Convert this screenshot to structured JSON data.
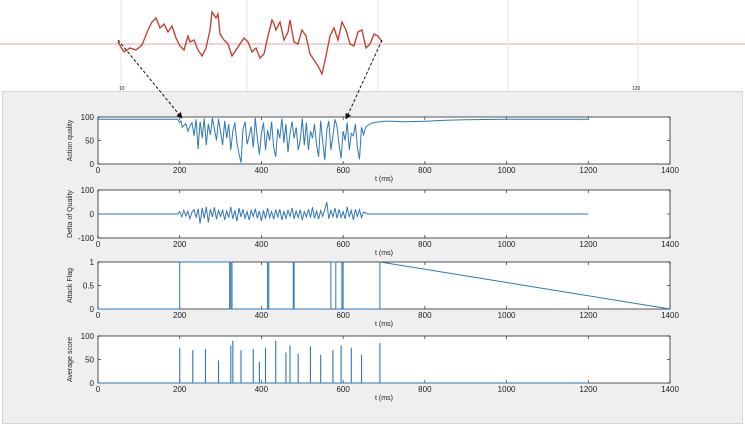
{
  "chart_data": [
    {
      "type": "line",
      "ylabel": "Action quality",
      "xlabel": "t (ms)",
      "xlim": [
        0,
        1400
      ],
      "ylim": [
        0,
        100
      ],
      "xticks": [
        "0",
        "200",
        "400",
        "600",
        "800",
        "1000",
        "1200",
        "1400"
      ],
      "yticks": [
        "0",
        "50",
        "100"
      ],
      "color": "#2f77b5",
      "series": [
        {
          "x": [
            0,
            195,
            200,
            203,
            206,
            210,
            215,
            220,
            225,
            230,
            235,
            240,
            245,
            250,
            255,
            260,
            265,
            270,
            275,
            280,
            285,
            290,
            295,
            300,
            305,
            310,
            315,
            320,
            325,
            330,
            335,
            340,
            345,
            350,
            355,
            360,
            365,
            370,
            375,
            380,
            385,
            390,
            395,
            400,
            405,
            410,
            415,
            420,
            425,
            430,
            435,
            440,
            445,
            450,
            455,
            460,
            465,
            470,
            475,
            480,
            485,
            490,
            495,
            500,
            505,
            510,
            515,
            520,
            525,
            530,
            535,
            540,
            545,
            550,
            555,
            560,
            565,
            570,
            575,
            580,
            585,
            590,
            595,
            600,
            605,
            610,
            615,
            620,
            625,
            630,
            635,
            640,
            645,
            650,
            655,
            660,
            670,
            680,
            690,
            700,
            720,
            750,
            800,
            850,
            900,
            1000,
            1100,
            1200
          ],
          "y": [
            95,
            95,
            88,
            92,
            78,
            82,
            86,
            70,
            80,
            88,
            60,
            95,
            32,
            90,
            55,
            97,
            40,
            85,
            62,
            98,
            75,
            50,
            96,
            68,
            40,
            92,
            55,
            85,
            30,
            70,
            88,
            45,
            22,
            3,
            75,
            90,
            42,
            60,
            80,
            35,
            98,
            55,
            20,
            65,
            88,
            30,
            72,
            50,
            90,
            35,
            15,
            75,
            55,
            97,
            45,
            85,
            25,
            65,
            90,
            55,
            78,
            30,
            50,
            97,
            40,
            88,
            30,
            70,
            55,
            85,
            40,
            15,
            92,
            48,
            8,
            72,
            92,
            30,
            60,
            95,
            80,
            40,
            12,
            70,
            50,
            88,
            30,
            65,
            60,
            85,
            35,
            10,
            78,
            62,
            78,
            82,
            87,
            89,
            90,
            91,
            91,
            90,
            91,
            93,
            94,
            95,
            95,
            95
          ]
        }
      ]
    },
    {
      "type": "line",
      "ylabel": "Delta of Quality",
      "xlabel": "t (ms)",
      "xlim": [
        0,
        1400
      ],
      "ylim": [
        -100,
        100
      ],
      "xticks": [
        "0",
        "200",
        "400",
        "600",
        "800",
        "1000",
        "1200",
        "1400"
      ],
      "yticks": [
        "-100",
        "0",
        "100"
      ],
      "color": "#2f77b5",
      "series": [
        {
          "x": [
            0,
            195,
            200,
            205,
            210,
            215,
            220,
            225,
            230,
            235,
            240,
            245,
            250,
            255,
            260,
            265,
            270,
            275,
            280,
            285,
            290,
            295,
            300,
            305,
            310,
            315,
            320,
            325,
            330,
            335,
            340,
            345,
            350,
            355,
            360,
            365,
            370,
            375,
            380,
            385,
            390,
            395,
            400,
            405,
            410,
            415,
            420,
            425,
            430,
            435,
            440,
            445,
            450,
            455,
            460,
            465,
            470,
            475,
            480,
            485,
            490,
            495,
            500,
            505,
            510,
            515,
            520,
            525,
            530,
            535,
            540,
            545,
            550,
            555,
            560,
            565,
            570,
            575,
            580,
            585,
            590,
            595,
            600,
            605,
            610,
            615,
            620,
            625,
            630,
            635,
            640,
            645,
            650,
            660,
            1200
          ],
          "y": [
            0,
            0,
            10,
            -12,
            15,
            -8,
            12,
            -20,
            8,
            18,
            -15,
            22,
            -40,
            25,
            -18,
            30,
            -35,
            20,
            -12,
            28,
            -22,
            15,
            -10,
            18,
            -25,
            12,
            -15,
            30,
            -20,
            15,
            -30,
            25,
            -12,
            20,
            -18,
            10,
            -25,
            15,
            -10,
            22,
            -18,
            12,
            -30,
            15,
            -20,
            25,
            -15,
            10,
            -22,
            18,
            -12,
            20,
            -25,
            12,
            -18,
            15,
            -10,
            25,
            -20,
            12,
            -15,
            18,
            -25,
            10,
            -12,
            20,
            -15,
            28,
            -18,
            12,
            -22,
            15,
            -10,
            18,
            50,
            -20,
            15,
            -12,
            25,
            -18,
            20,
            -15,
            10,
            -20,
            30,
            -12,
            15,
            -25,
            20,
            -10,
            18,
            -15,
            8,
            0,
            0
          ]
        }
      ]
    },
    {
      "type": "line",
      "ylabel": "Attack Flag",
      "xlabel": "t (ms)",
      "xlim": [
        0,
        1400
      ],
      "ylim": [
        0,
        1
      ],
      "xticks": [
        "0",
        "200",
        "400",
        "600",
        "800",
        "1000",
        "1200",
        "1400"
      ],
      "yticks": [
        "0",
        "0.5",
        "1"
      ],
      "color": "#2f77b5",
      "series": [
        {
          "x": [
            0,
            200,
            200,
            322,
            322,
            325,
            325,
            328,
            328,
            415,
            415,
            418,
            418,
            478,
            478,
            480,
            480,
            570,
            570,
            582,
            582,
            597,
            597,
            600,
            600,
            690,
            690,
            1400
          ],
          "y": [
            0,
            0,
            1,
            1,
            0,
            0,
            1,
            1,
            0,
            0,
            1,
            1,
            0,
            0,
            1,
            1,
            0,
            0,
            1,
            1,
            0,
            0,
            1,
            1,
            0,
            0,
            1,
            0
          ]
        }
      ]
    },
    {
      "type": "line",
      "ylabel": "Average score",
      "xlabel": "t (ms)",
      "xlim": [
        0,
        1400
      ],
      "ylim": [
        0,
        100
      ],
      "xticks": [
        "0",
        "200",
        "400",
        "600",
        "800",
        "1000",
        "1200",
        "1400"
      ],
      "yticks": [
        "0",
        "50",
        "100"
      ],
      "color": "#2f77b5",
      "spikes": {
        "x": [
          200,
          232,
          263,
          295,
          325,
          330,
          350,
          380,
          395,
          410,
          435,
          460,
          470,
          490,
          520,
          545,
          575,
          595,
          620,
          645,
          690
        ],
        "y": [
          75,
          70,
          72,
          48,
          80,
          90,
          70,
          72,
          45,
          75,
          90,
          65,
          80,
          62,
          78,
          60,
          70,
          80,
          75,
          60,
          85
        ]
      }
    }
  ],
  "top_strip": {
    "description_color": "#d23a3a",
    "trace_color": "#c0392b"
  }
}
